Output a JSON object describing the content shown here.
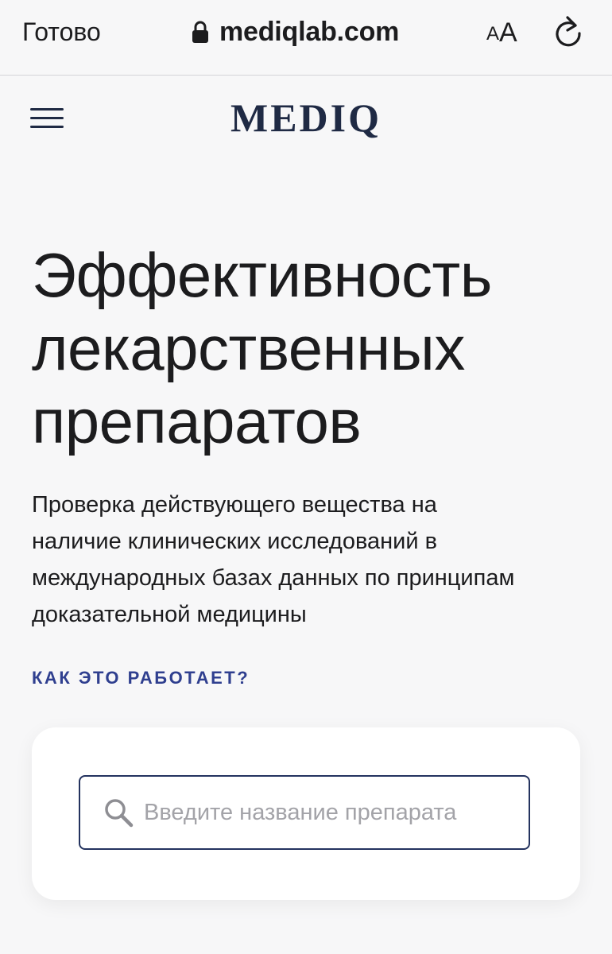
{
  "browser": {
    "done_label": "Готово",
    "url": "mediqlab.com",
    "text_size_small": "A",
    "text_size_large": "A",
    "icons": {
      "lock": "lock-icon",
      "reload": "reload-icon"
    }
  },
  "header": {
    "logo": "MEDIQ",
    "menu_icon": "hamburger-menu-icon"
  },
  "hero": {
    "title_lines": [
      "Эффективность",
      "лекарственных",
      "препаратов"
    ],
    "description_lines": [
      "Проверка действующего вещества на",
      "наличие клинических исследований в",
      "международных базах данных по принципам",
      "доказательной медицины"
    ],
    "how_link": "КАК ЭТО РАБОТАЕТ?"
  },
  "search": {
    "placeholder": "Введите название препарата",
    "value": "",
    "icon": "search-icon"
  },
  "colors": {
    "brand": "#1f2a44",
    "link": "#2f3f8f",
    "field_border": "#24335f",
    "background": "#f7f7f8",
    "card": "#ffffff"
  }
}
